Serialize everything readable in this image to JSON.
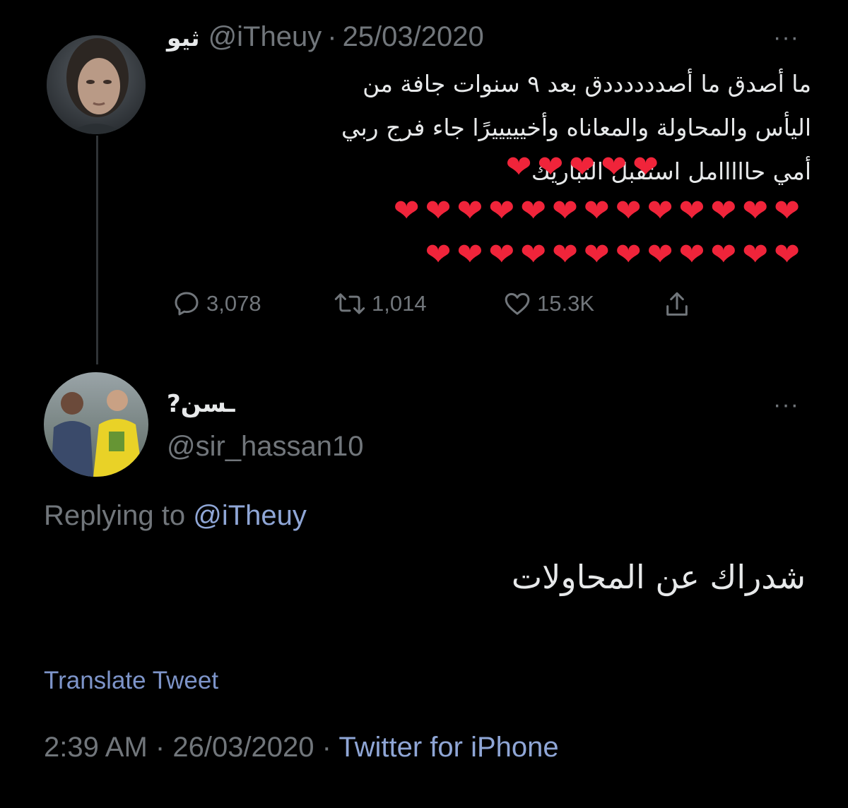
{
  "colors": {
    "background": "#000000",
    "text_primary": "#e7e9ea",
    "text_secondary": "#71767b",
    "link": "#8fa6d6",
    "heart": "#f0243a",
    "thread_line": "#2f3336"
  },
  "original_tweet": {
    "avatar_icon": "avatar-woman-portrait",
    "display_name": "ثيو",
    "handle": "@iTheuy",
    "separator": "·",
    "date": "25/03/2020",
    "more_icon": "more-dots-icon",
    "more_label": "···",
    "text_lines": [
      "ما أصدق ما أصددددددق بعد ٩ سنوات جافة من",
      "اليأس والمحاولة والمعاناه وأخيييييرًا جاء فرج ربي",
      "أمي حااااامل استقبل التباريك"
    ],
    "heart_rows": [
      "❤❤❤❤❤",
      "❤❤❤❤❤❤❤❤❤❤❤❤❤",
      "❤❤❤❤❤❤❤❤❤❤❤❤"
    ],
    "stats": {
      "replies": "3,078",
      "retweets": "1,014",
      "likes": "15.3K"
    },
    "action_icons": [
      "reply-icon",
      "retweet-icon",
      "like-icon",
      "share-icon"
    ]
  },
  "reply_tweet": {
    "avatar_icon": "avatar-footballers-photo",
    "display_name": "?ـسن",
    "handle": "@sir_hassan10",
    "more_label": "···",
    "replying_prefix": "Replying to",
    "replying_handle": "@iTheuy",
    "text": "شدراك عن المحاولات",
    "translate_label": "Translate Tweet",
    "time": "2:39 AM",
    "separator": "·",
    "date": "26/03/2020",
    "source": "Twitter for iPhone"
  }
}
